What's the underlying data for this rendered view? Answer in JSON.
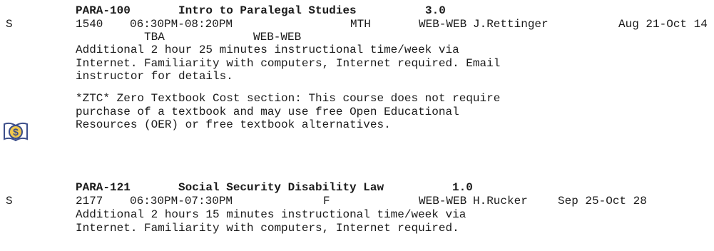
{
  "courses": [
    {
      "code": "PARA-100",
      "title": "Intro to Paralegal Studies",
      "units": "3.0",
      "status": "S",
      "section": "1540",
      "time": "06:30PM-08:20PM",
      "days": "MTH",
      "location": "WEB-WEB",
      "instructor": "J.Rettinger",
      "dates": "Aug 21-Oct 14",
      "tba_time": "TBA",
      "tba_location": "WEB-WEB",
      "notes": [
        "Additional 2 hour 25 minutes instructional time/week via",
        "Internet. Familiarity with computers, Internet required. Email",
        "instructor for details."
      ],
      "ztc_notes": [
        "*ZTC* Zero Textbook Cost section: This course does not require",
        "purchase of a textbook and may use free Open Educational",
        "Resources (OER) or free textbook alternatives."
      ],
      "ztc_icon": "zero-textbook-cost-icon"
    },
    {
      "code": "PARA-121",
      "title": "Social Security Disability Law",
      "units": "1.0",
      "status": "S",
      "section": "2177",
      "time": "06:30PM-07:30PM",
      "days": "F",
      "location": "WEB-WEB",
      "instructor": "H.Rucker",
      "dates": "Sep 25-Oct 28",
      "notes": [
        "Additional 2 hours 15 minutes instructional time/week via",
        "Internet. Familiarity with computers, Internet required."
      ]
    }
  ],
  "colors": {
    "icon_stroke": "#3c4e8a",
    "icon_fill": "#f2c94c"
  }
}
